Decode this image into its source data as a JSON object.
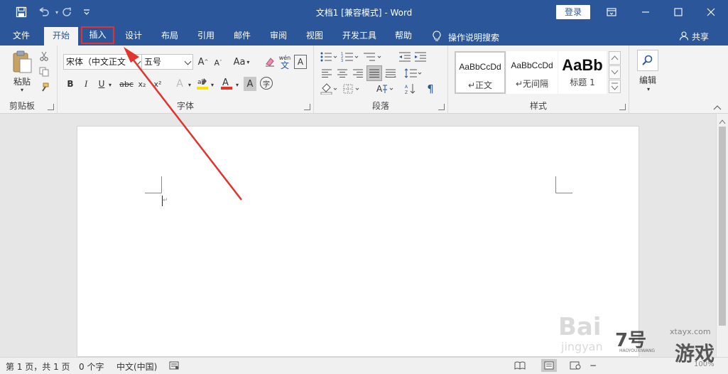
{
  "titlebar": {
    "title": "文档1 [兼容模式] - Word",
    "login_label": "登录",
    "icons": [
      "save-icon",
      "undo-icon",
      "redo-icon",
      "customize-qat-icon",
      "ribbon-display-icon",
      "minimize-icon",
      "maximize-icon",
      "close-icon"
    ]
  },
  "tabs": [
    {
      "label": "文件"
    },
    {
      "label": "开始"
    },
    {
      "label": "插入"
    },
    {
      "label": "设计"
    },
    {
      "label": "布局"
    },
    {
      "label": "引用"
    },
    {
      "label": "邮件"
    },
    {
      "label": "审阅"
    },
    {
      "label": "视图"
    },
    {
      "label": "开发工具"
    },
    {
      "label": "帮助"
    }
  ],
  "tell_me": "操作说明搜索",
  "share": "共享",
  "ribbon": {
    "clipboard": {
      "label": "剪贴板",
      "paste_label": "粘贴"
    },
    "font": {
      "label": "字体",
      "font_name": "宋体（中文正文",
      "font_size": "五号",
      "case_label": "Aa",
      "phonetic_label": "wén",
      "bold": "B",
      "italic": "I",
      "underline": "U",
      "strike": "abc",
      "subscript": "x₂",
      "superscript": "x²",
      "font_color_letter": "A",
      "char_shading_letter": "A",
      "enclose_char": "字",
      "highlight_color": "#f3e500",
      "font_color": "#e2332c"
    },
    "paragraph": {
      "label": "段落"
    },
    "styles": {
      "label": "样式",
      "items": [
        {
          "sample": "AaBbCcDd",
          "name": "↵正文"
        },
        {
          "sample": "AaBbCcDd",
          "name": "↵无间隔"
        },
        {
          "sample": "AaBb",
          "name": "标题 1"
        }
      ]
    },
    "editing": {
      "label": "编辑"
    }
  },
  "status": {
    "page": "第 1 页，共 1 页",
    "words": "0 个字",
    "language": "中文(中国)",
    "zoom": "100%"
  },
  "watermarks": {
    "baidu": "Bai",
    "baidu_jingyan": "jingyan",
    "site_domain": "xtayx.com",
    "site_number": "7号",
    "site_name": "游戏",
    "site_small": "HAOYOUXIWANG"
  },
  "colors": {
    "word_blue": "#2b579a",
    "annotation_red": "#e2332c"
  }
}
